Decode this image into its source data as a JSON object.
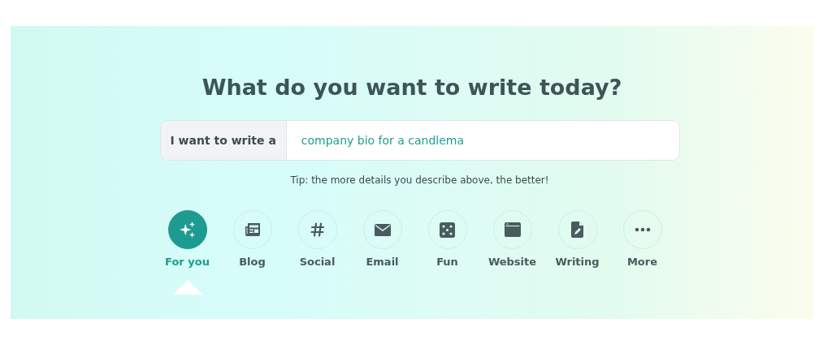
{
  "heading": "What do you want to write today?",
  "prompt": {
    "label": "I want to write a",
    "value": "company bio for a candlema"
  },
  "tip": "Tip: the more details you describe above, the better!",
  "categories": [
    {
      "label": "For you",
      "kind": "sparkles",
      "selected": true
    },
    {
      "label": "Blog",
      "kind": "newspaper",
      "selected": false
    },
    {
      "label": "Social",
      "kind": "hash",
      "selected": false
    },
    {
      "label": "Email",
      "kind": "envelope",
      "selected": false
    },
    {
      "label": "Fun",
      "kind": "dice",
      "selected": false
    },
    {
      "label": "Website",
      "kind": "browser",
      "selected": false
    },
    {
      "label": "Writing",
      "kind": "document",
      "selected": false
    },
    {
      "label": "More",
      "kind": "dots",
      "selected": false
    }
  ]
}
